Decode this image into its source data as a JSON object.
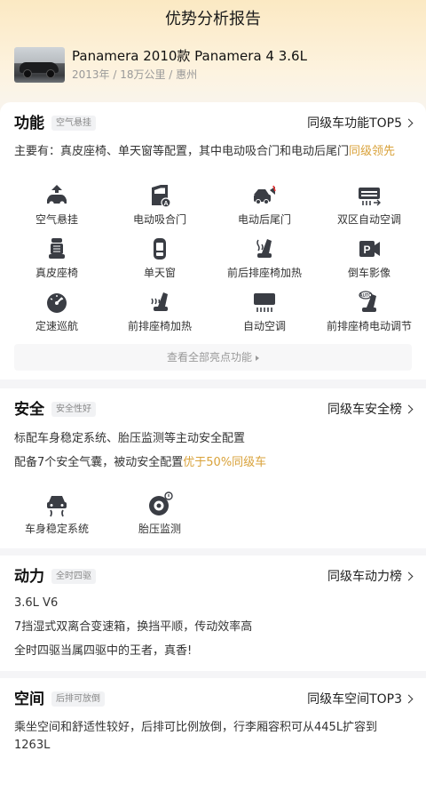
{
  "page": {
    "title": "优势分析报告"
  },
  "car": {
    "name": "Panamera 2010款 Panamera 4 3.6L",
    "meta": "2013年 / 18万公里 / 惠州"
  },
  "function": {
    "heading": "功能",
    "tag": "空气悬挂",
    "rank": "同级车功能TOP5",
    "desc_text": "主要有：真皮座椅、单天窗等配置，其中电动吸合门和电动后尾门",
    "desc_highlight": "同级领先",
    "items": [
      {
        "label": "空气悬挂",
        "icon": "air-suspension-icon"
      },
      {
        "label": "电动吸合门",
        "icon": "soft-close-door-icon"
      },
      {
        "label": "电动后尾门",
        "icon": "power-tailgate-icon"
      },
      {
        "label": "双区自动空调",
        "icon": "dual-zone-ac-icon"
      },
      {
        "label": "真皮座椅",
        "icon": "leather-seat-icon"
      },
      {
        "label": "单天窗",
        "icon": "sunroof-icon"
      },
      {
        "label": "前后排座椅加热",
        "icon": "seat-heating-icon"
      },
      {
        "label": "倒车影像",
        "icon": "parking-camera-icon"
      },
      {
        "label": "定速巡航",
        "icon": "cruise-control-icon"
      },
      {
        "label": "前排座椅加热",
        "icon": "front-seat-heating-icon"
      },
      {
        "label": "自动空调",
        "icon": "auto-ac-icon"
      },
      {
        "label": "前排座椅电动调节",
        "icon": "power-seat-icon"
      }
    ],
    "more_label": "查看全部亮点功能"
  },
  "safety": {
    "heading": "安全",
    "tag": "安全性好",
    "rank": "同级车安全榜",
    "line1": "标配车身稳定系统、胎压监测等主动安全配置",
    "line2_text": "配备7个安全气囊，被动安全配置",
    "line2_highlight": "优于50%同级车",
    "items": [
      {
        "label": "车身稳定系统",
        "icon": "stability-control-icon"
      },
      {
        "label": "胎压监测",
        "icon": "tire-pressure-icon"
      }
    ]
  },
  "power": {
    "heading": "动力",
    "tag": "全时四驱",
    "rank": "同级车动力榜",
    "lines": [
      "3.6L V6",
      "7挡湿式双离合变速箱，换挡平顺，传动效率高",
      "全时四驱当属四驱中的王者，真香!"
    ]
  },
  "space": {
    "heading": "空间",
    "tag": "后排可放倒",
    "rank": "同级车空间TOP3",
    "desc": "乘坐空间和舒适性较好，后排可比例放倒，行李厢容积可从445L扩容到1263L"
  }
}
